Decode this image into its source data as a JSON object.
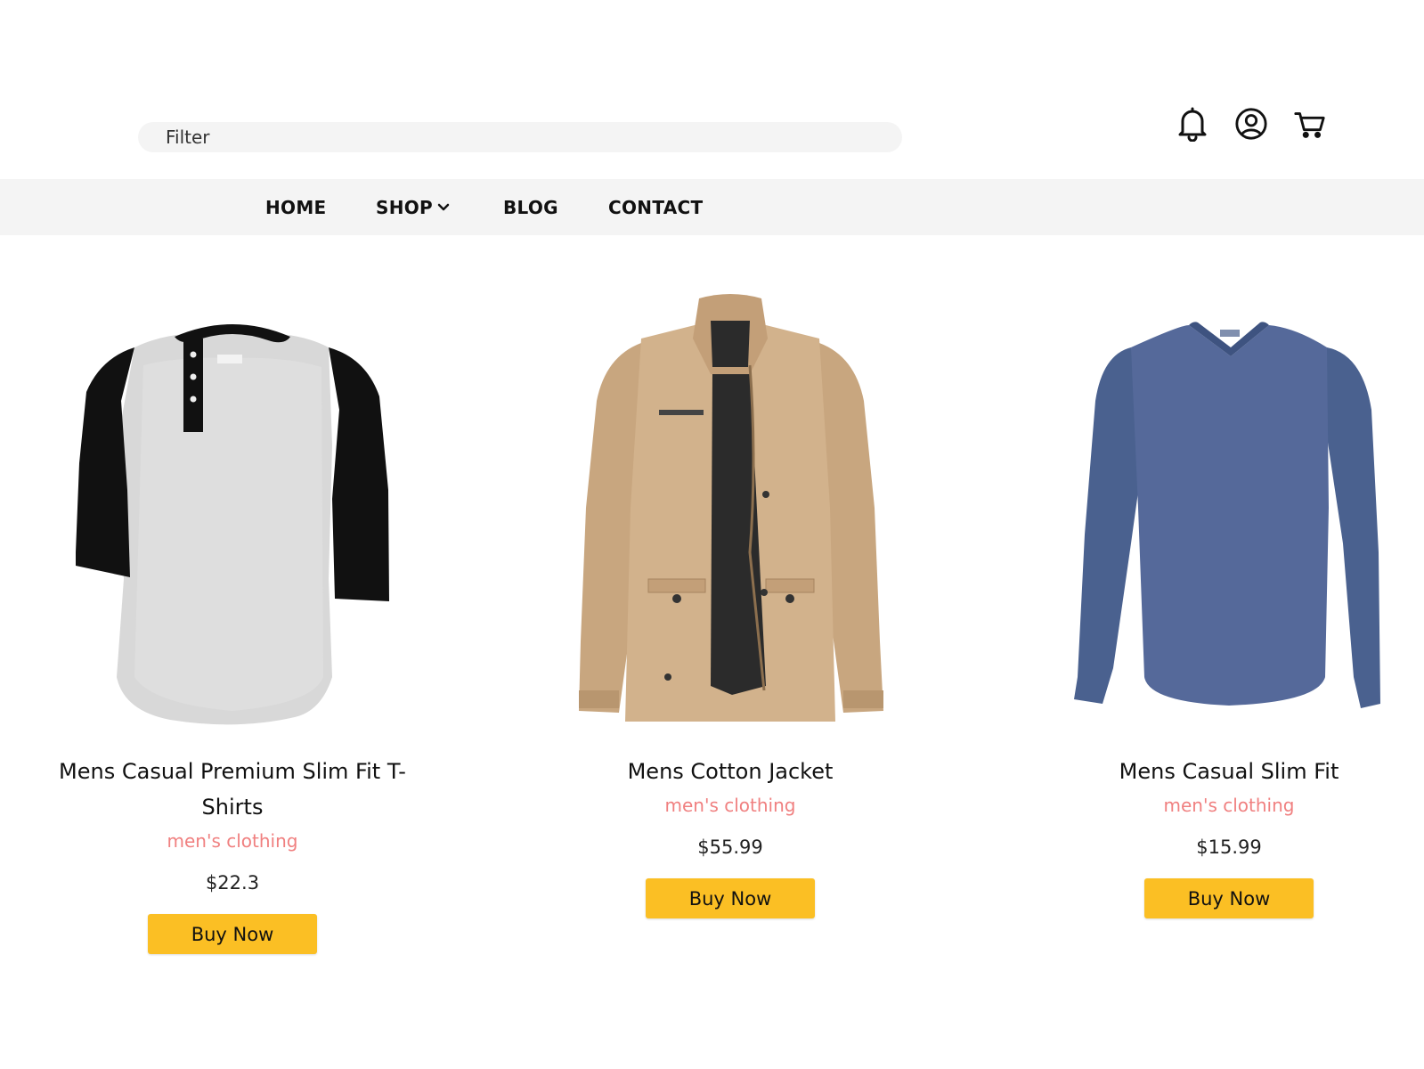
{
  "search": {
    "placeholder": "Filter"
  },
  "header_icons": [
    "bell-icon",
    "user-icon",
    "cart-icon"
  ],
  "nav": {
    "items": [
      {
        "label": "HOME"
      },
      {
        "label": "SHOP",
        "has_dropdown": true
      },
      {
        "label": "BLOG"
      },
      {
        "label": "CONTACT"
      }
    ]
  },
  "colors": {
    "accent": "#fbbf24",
    "category": "#f08080",
    "nav_bg": "#f4f4f4"
  },
  "products": [
    {
      "title": "Mens Casual Premium Slim Fit T-Shirts",
      "category": "men's clothing",
      "price": "$22.3",
      "button_label": "Buy Now",
      "image": "raglan-henley-tshirt"
    },
    {
      "title": "Mens Cotton Jacket",
      "category": "men's clothing",
      "price": "$55.99",
      "button_label": "Buy Now",
      "image": "khaki-cotton-jacket"
    },
    {
      "title": "Mens Casual Slim Fit",
      "category": "men's clothing",
      "price": "$15.99",
      "button_label": "Buy Now",
      "image": "blue-vneck-longsleeve"
    }
  ]
}
